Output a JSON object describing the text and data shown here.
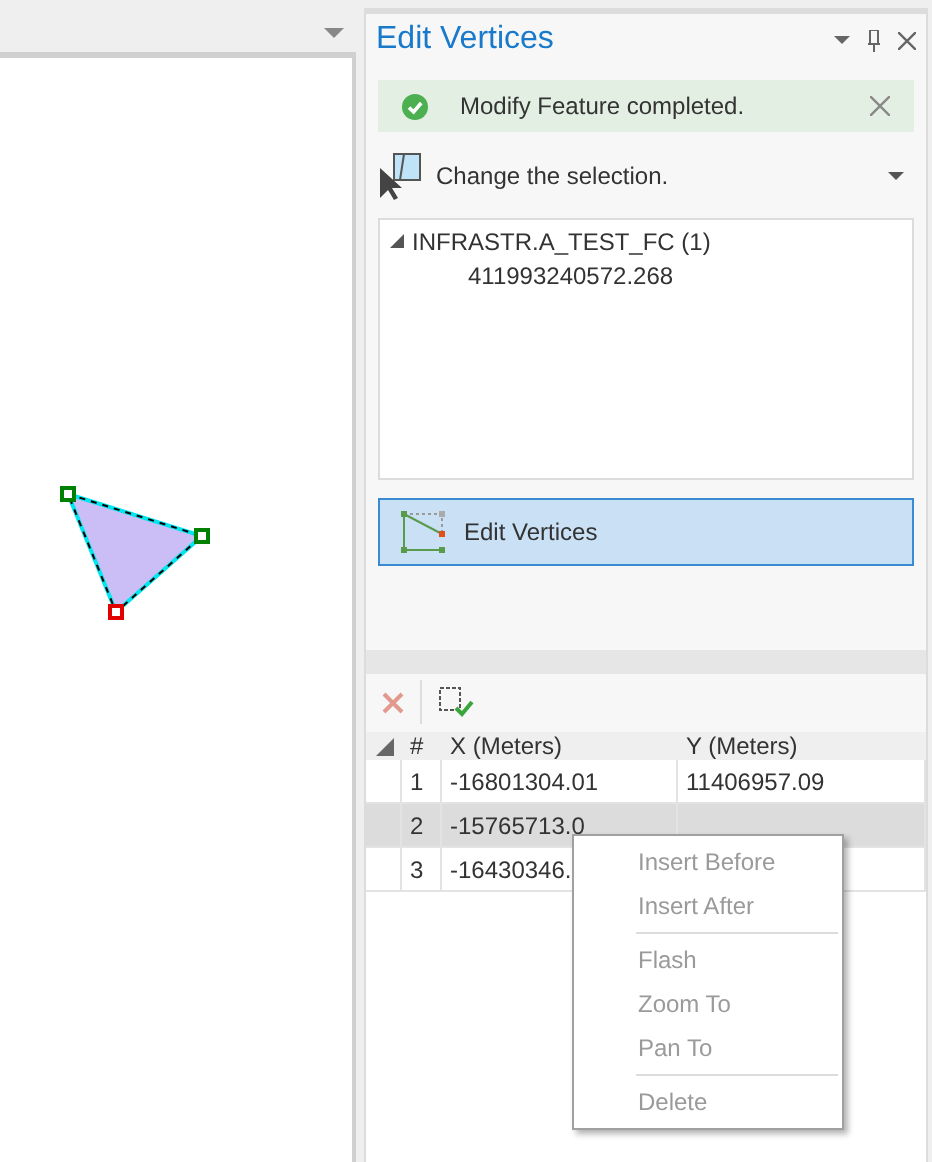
{
  "panel": {
    "title": "Edit Vertices"
  },
  "message": {
    "text": "Modify Feature completed."
  },
  "selection_tool": {
    "label": "Change the selection."
  },
  "tree": [
    {
      "label": "INFRASTR.A_TEST_FC (1)",
      "expanded": true,
      "children": [
        {
          "label": "411993240572.268"
        }
      ]
    }
  ],
  "edit_button": {
    "label": "Edit Vertices",
    "selected": true
  },
  "table": {
    "columns": [
      "#",
      "X (Meters)",
      "Y (Meters)"
    ],
    "rows": [
      {
        "cells": [
          "1",
          "-16801304.01",
          "11406957.09"
        ],
        "selected": false
      },
      {
        "cells": [
          "2",
          "-15765713.0",
          ""
        ],
        "selected": true
      },
      {
        "cells": [
          "3",
          "-16430346.",
          ""
        ],
        "selected": false
      }
    ]
  },
  "context_menu": {
    "groups": [
      [
        {
          "label": "Insert Before",
          "disabled": true
        },
        {
          "label": "Insert After",
          "disabled": true
        }
      ],
      [
        {
          "label": "Flash",
          "disabled": true
        },
        {
          "label": "Zoom To",
          "disabled": true
        },
        {
          "label": "Pan To",
          "disabled": true
        }
      ],
      [
        {
          "label": "Delete",
          "disabled": true
        }
      ]
    ]
  }
}
